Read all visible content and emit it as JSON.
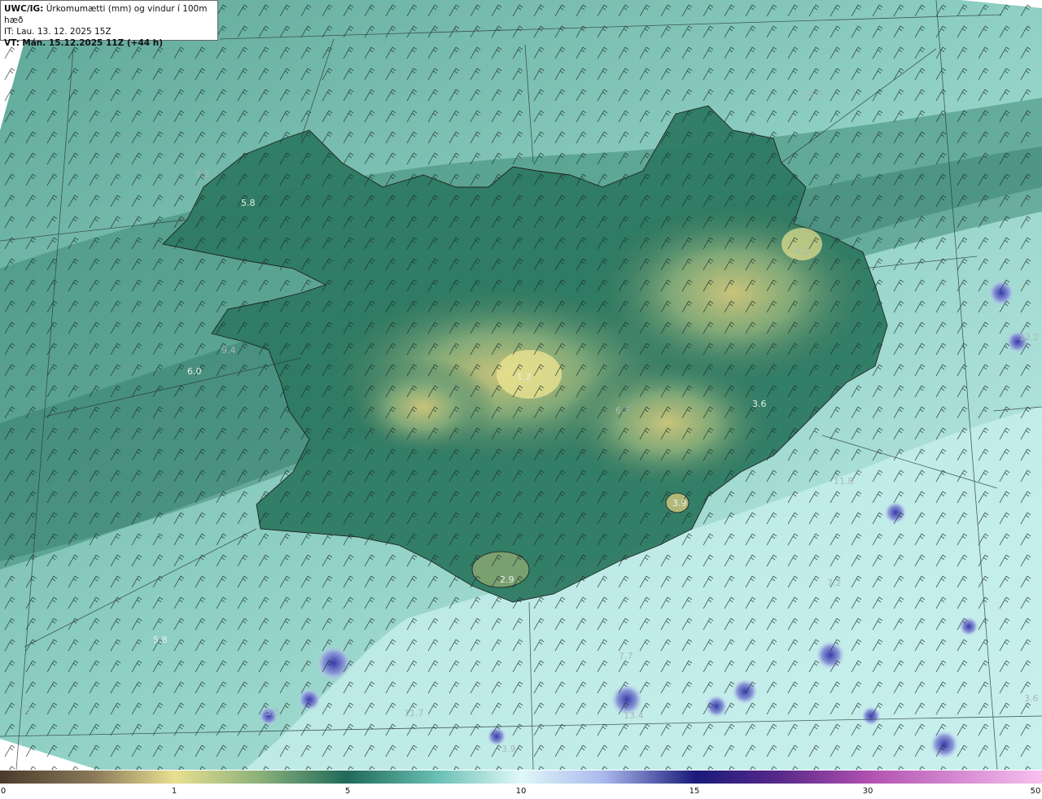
{
  "header": {
    "line1_prefix": "UWC/IG:",
    "line1_text": "Úrkomumætti (mm) og vindur í 100m hæð",
    "line2": "IT: Lau. 13. 12. 2025 15Z",
    "line3_prefix": "VT:",
    "line3_text": "Mán. 15.12.2025 11Z (+44 h)"
  },
  "map_labels": {
    "west_fjords_a": "9.2",
    "west_fjords_b": "5.8",
    "west_a": "6.0",
    "west_b": "9.4",
    "interior": "1.2",
    "east_a": "3.6",
    "east_b": "3.9",
    "south_island": "2.9",
    "sea_sw": "5.8",
    "sea_sw_corner": "7.2",
    "sea_s_a": "3.5",
    "sea_s_b": "11.7",
    "sea_s_c": "13.4",
    "sea_s_d": "3.9",
    "sea_se_a": "7.2",
    "sea_se_b": "11.8",
    "sea_e": "12.2",
    "sea_ne": "16.3",
    "sea_se_c": "3.6",
    "sea_s_e": "7.7",
    "north_a": "4.1",
    "north_b": "6.7"
  },
  "colorbar": {
    "ticks": [
      "0",
      "1",
      "5",
      "10",
      "15",
      "30",
      "50"
    ],
    "colors": [
      "#4a3a2a",
      "#8a7a55",
      "#d8d48a",
      "#4a8a6a",
      "#2e6a5a",
      "#7fcfc8",
      "#d8f4f4",
      "#b8c8f0",
      "#4a4ab0",
      "#1a1a70",
      "#a048a8",
      "#f0a0e0"
    ]
  }
}
